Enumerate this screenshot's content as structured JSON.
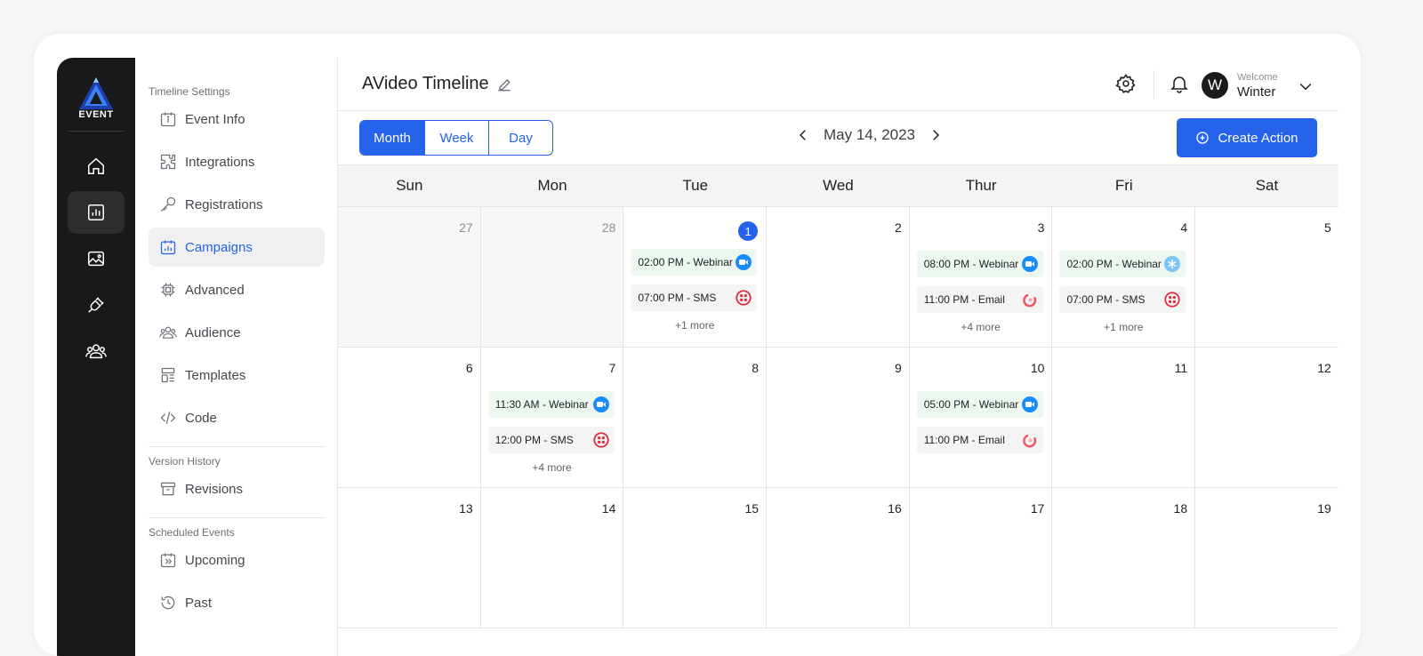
{
  "brand": {
    "logo_text": "EVENT"
  },
  "rail": {
    "items": [
      {
        "icon": "home-icon",
        "active": false
      },
      {
        "icon": "chart-icon",
        "active": true
      },
      {
        "icon": "image-icon",
        "active": false
      },
      {
        "icon": "plug-icon",
        "active": false
      },
      {
        "icon": "users-icon",
        "active": false
      }
    ]
  },
  "subnav": {
    "timeline_settings": "Timeline Settings",
    "version_history": "Version History",
    "scheduled_events": "Scheduled Events",
    "items": {
      "event_info": "Event Info",
      "integrations": "Integrations",
      "registrations": "Registrations",
      "campaigns": "Campaigns",
      "advanced": "Advanced",
      "audience": "Audience",
      "templates": "Templates",
      "code": "Code",
      "revisions": "Revisions",
      "upcoming": "Upcoming",
      "past": "Past"
    },
    "active": "campaigns"
  },
  "header": {
    "title": "AVideo Timeline",
    "welcome": "Welcome",
    "user_name": "Winter",
    "avatar_letter": "W"
  },
  "toolbar": {
    "views": [
      "Month",
      "Week",
      "Day"
    ],
    "active_view": "Month",
    "current_date": "May 14, 2023",
    "create_label": "Create Action"
  },
  "calendar": {
    "weekdays": [
      "Sun",
      "Mon",
      "Tue",
      "Wed",
      "Thur",
      "Fri",
      "Sat"
    ],
    "weeks": [
      [
        {
          "day": "27",
          "past": true,
          "events": []
        },
        {
          "day": "28",
          "past": true,
          "events": []
        },
        {
          "day": "1",
          "today": true,
          "events": [
            {
              "label": "02:00 PM - Webinar",
              "type": "webinar",
              "icon": "zoom-icon"
            },
            {
              "label": "07:00 PM - SMS",
              "type": "sms",
              "icon": "twilio-icon"
            }
          ],
          "more": "+1 more"
        },
        {
          "day": "2",
          "events": []
        },
        {
          "day": "3",
          "events": [
            {
              "label": "08:00 PM - Webinar",
              "type": "webinar",
              "icon": "zoom-icon"
            },
            {
              "label": "11:00 PM - Email",
              "type": "email",
              "icon": "email-provider-icon"
            }
          ],
          "more": "+4 more"
        },
        {
          "day": "4",
          "events": [
            {
              "label": "02:00 PM - Webinar",
              "type": "webinar",
              "icon": "snowflake-icon"
            },
            {
              "label": "07:00 PM - SMS",
              "type": "sms",
              "icon": "twilio-icon"
            }
          ],
          "more": "+1 more"
        },
        {
          "day": "5",
          "events": []
        }
      ],
      [
        {
          "day": "6",
          "events": []
        },
        {
          "day": "7",
          "events": [
            {
              "label": "11:30 AM - Webinar",
              "type": "webinar",
              "icon": "zoom-icon"
            },
            {
              "label": "12:00 PM - SMS",
              "type": "sms",
              "icon": "twilio-icon"
            }
          ],
          "more": "+4 more"
        },
        {
          "day": "8",
          "events": []
        },
        {
          "day": "9",
          "events": []
        },
        {
          "day": "10",
          "events": [
            {
              "label": "05:00 PM - Webinar",
              "type": "webinar",
              "icon": "zoom-icon"
            },
            {
              "label": "11:00 PM - Email",
              "type": "email",
              "icon": "email-provider-icon"
            }
          ]
        },
        {
          "day": "11",
          "events": []
        },
        {
          "day": "12",
          "events": []
        }
      ],
      [
        {
          "day": "13",
          "events": []
        },
        {
          "day": "14",
          "events": []
        },
        {
          "day": "15",
          "events": []
        },
        {
          "day": "16",
          "events": []
        },
        {
          "day": "17",
          "events": []
        },
        {
          "day": "18",
          "events": []
        },
        {
          "day": "19",
          "events": []
        }
      ]
    ]
  },
  "colors": {
    "accent": "#2563eb",
    "rail_bg": "#191919",
    "webinar_bg": "#ecf7ef",
    "zoom": "#1a8cff",
    "twilio": "#e02b3f",
    "email_provider": "#f0535e"
  }
}
